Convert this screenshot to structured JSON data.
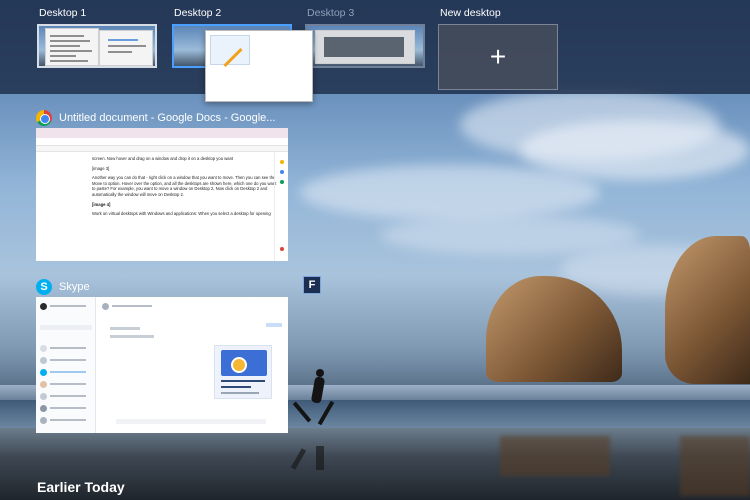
{
  "desktops": [
    {
      "label": "Desktop 1",
      "state": "normal"
    },
    {
      "label": "Desktop 2",
      "state": "active"
    },
    {
      "label": "Desktop 3",
      "state": "dim"
    },
    {
      "label": "New desktop",
      "state": "new"
    }
  ],
  "new_desktop_glyph": "+",
  "windows": {
    "docs": {
      "title": "Untitled document - Google Docs - Google...",
      "icon": "chrome-icon",
      "paragraphs": [
        "screen. Now hover and drag on a window and drop it on a desktop you want",
        "[image 3]",
        "Another way you can do that - right click on a window that you want to move. Then you can see the Move to option. Hover over the option, and all the desktops are shown here, which one do you want to paste? For example, you want to move a window on Desktop 2, Now click on Desktop 2 and automatically the window will move on Desktop 2.",
        "[image 4]",
        "Work on virtual desktops with Windows and applications: When you select a desktop for opening"
      ]
    },
    "skype": {
      "title": "Skype",
      "icon": "skype-icon"
    }
  },
  "overlay_badge": "F",
  "section_label": "Earlier Today",
  "colors": {
    "bar": "#1c2c48",
    "active_border": "#4aa0ff",
    "skype": "#00aff0"
  }
}
